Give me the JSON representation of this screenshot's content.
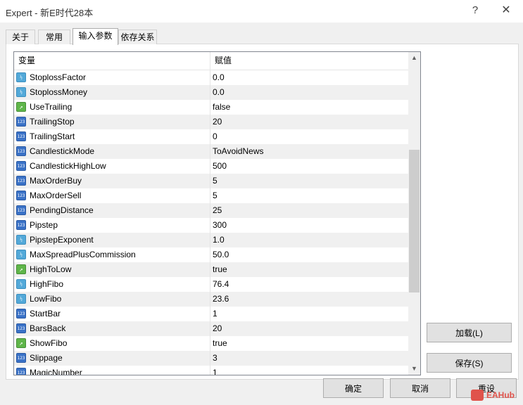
{
  "window": {
    "title": "Expert - 新E时代28本",
    "help_glyph": "?",
    "close_glyph": "✕"
  },
  "tabs": [
    {
      "label": "关于"
    },
    {
      "label": "常用"
    },
    {
      "label": "输入参数",
      "active": true
    },
    {
      "label": "依存关系"
    }
  ],
  "grid": {
    "header": {
      "variable": "变量",
      "value": "赋值"
    },
    "rows": [
      {
        "name": "StoplossFactor",
        "value": "0.0",
        "type": "double"
      },
      {
        "name": "StoplossMoney",
        "value": "0.0",
        "type": "double"
      },
      {
        "name": "UseTrailing",
        "value": "false",
        "type": "bool"
      },
      {
        "name": "TrailingStop",
        "value": "20",
        "type": "int"
      },
      {
        "name": "TrailingStart",
        "value": "0",
        "type": "int"
      },
      {
        "name": "CandlestickMode",
        "value": "ToAvoidNews",
        "type": "enum"
      },
      {
        "name": "CandlestickHighLow",
        "value": "500",
        "type": "int"
      },
      {
        "name": "MaxOrderBuy",
        "value": "5",
        "type": "int"
      },
      {
        "name": "MaxOrderSell",
        "value": "5",
        "type": "int"
      },
      {
        "name": "PendingDistance",
        "value": "25",
        "type": "int"
      },
      {
        "name": "Pipstep",
        "value": "300",
        "type": "int"
      },
      {
        "name": "PipstepExponent",
        "value": "1.0",
        "type": "double"
      },
      {
        "name": "MaxSpreadPlusCommission",
        "value": "50.0",
        "type": "double"
      },
      {
        "name": "HighToLow",
        "value": "true",
        "type": "bool"
      },
      {
        "name": "HighFibo",
        "value": "76.4",
        "type": "double"
      },
      {
        "name": "LowFibo",
        "value": "23.6",
        "type": "double"
      },
      {
        "name": "StartBar",
        "value": "1",
        "type": "int"
      },
      {
        "name": "BarsBack",
        "value": "20",
        "type": "int"
      },
      {
        "name": "ShowFibo",
        "value": "true",
        "type": "bool"
      },
      {
        "name": "Slippage",
        "value": "3",
        "type": "int"
      },
      {
        "name": "MagicNumber",
        "value": "1",
        "type": "int"
      }
    ],
    "icon_text": {
      "int": "123",
      "double": "½",
      "bool": "↗",
      "enum": "123"
    }
  },
  "buttons": {
    "load": "加载(L)",
    "save": "保存(S)",
    "ok": "确定",
    "cancel": "取消",
    "reset": "重设"
  },
  "watermark": "EAHub"
}
